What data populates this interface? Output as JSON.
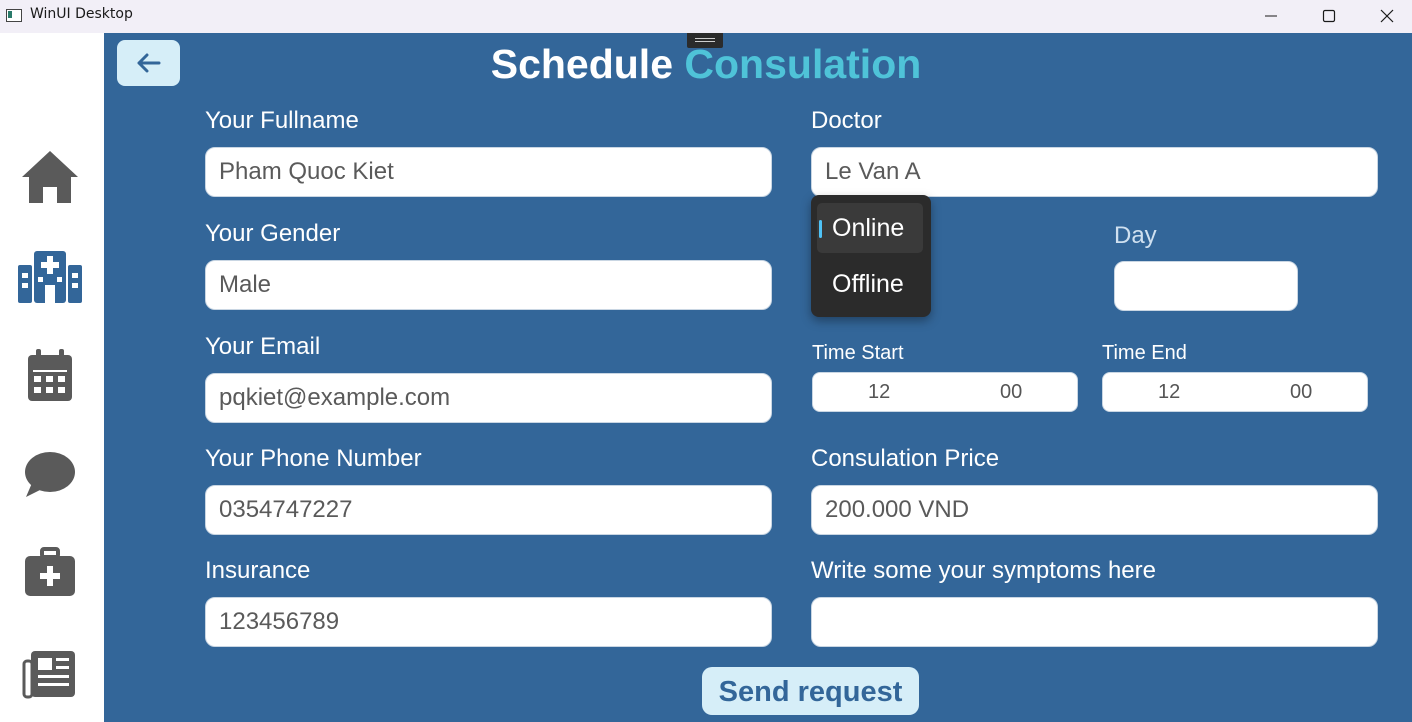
{
  "window": {
    "title": "WinUI Desktop"
  },
  "sidebar": {
    "items": [
      {
        "icon": "home-icon"
      },
      {
        "icon": "hospital-icon"
      },
      {
        "icon": "calendar-icon"
      },
      {
        "icon": "chat-icon"
      },
      {
        "icon": "medical-kit-icon"
      },
      {
        "icon": "news-icon"
      }
    ]
  },
  "header": {
    "title_part1": "Schedule",
    "title_part2": "Consulation"
  },
  "form": {
    "fullname_label": "Your Fullname",
    "fullname_value": "Pham Quoc Kiet",
    "gender_label": "Your Gender",
    "gender_value": "Male",
    "email_label": "Your Email",
    "email_value": "pqkiet@example.com",
    "phone_label": "Your Phone Number",
    "phone_value": "0354747227",
    "insurance_label": "Insurance",
    "insurance_value": "123456789",
    "doctor_label": "Doctor",
    "doctor_value": "Le Van A",
    "day_label": "Day",
    "day_value": "",
    "time_start_label": "Time Start",
    "time_start_hour": "12",
    "time_start_minute": "00",
    "time_end_label": "Time End",
    "time_end_hour": "12",
    "time_end_minute": "00",
    "price_label": "Consulation Price",
    "price_value": "200.000 VND",
    "symptoms_label": "Write some your symptoms here",
    "symptoms_value": "",
    "mode_options": [
      "Online",
      "Offline"
    ],
    "mode_selected": "Online",
    "send_label": "Send request"
  },
  "colors": {
    "main_bg": "#336699",
    "accent": "#4fc3d8",
    "button_bg": "#d6eef8",
    "dropdown_bg": "#2b2b2b"
  }
}
